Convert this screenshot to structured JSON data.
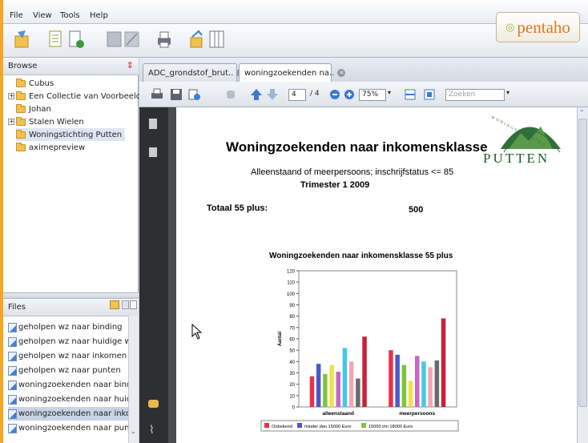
{
  "menu": {
    "file": "File",
    "view": "View",
    "tools": "Tools",
    "help": "Help"
  },
  "brand": {
    "logo_text": "pentaho",
    "accent": "#e07a1f"
  },
  "browse": {
    "header": "Browse",
    "folders": [
      {
        "label": "Cubus",
        "expandable": false
      },
      {
        "label": "Een Collectie van Voorbeelden",
        "expandable": true
      },
      {
        "label": "Johan",
        "expandable": false
      },
      {
        "label": "Stalen Wielen",
        "expandable": true
      },
      {
        "label": "Woningstichting Putten",
        "expandable": false,
        "selected": true
      },
      {
        "label": "aximepreview",
        "expandable": false
      }
    ]
  },
  "files": {
    "header": "Files",
    "items": [
      {
        "label": "geholpen wz naar binding"
      },
      {
        "label": "geholpen wz naar huidige woon"
      },
      {
        "label": "geholpen wz naar inkomen"
      },
      {
        "label": "geholpen wz naar punten"
      },
      {
        "label": "woningzoekenden naar binding"
      },
      {
        "label": "woningzoekenden naar huidige"
      },
      {
        "label": "woningzoekenden naar inkomer",
        "selected": true
      },
      {
        "label": "woningzoekenden naar punten"
      }
    ]
  },
  "tabs": [
    {
      "label": "ADC_grondstof_brut..",
      "active": false
    },
    {
      "label": "woningzoekenden na..",
      "active": true
    }
  ],
  "pdf_toolbar": {
    "page_current": "4",
    "page_total": "/ 4",
    "zoom": "75%",
    "search_placeholder": "Zoeken"
  },
  "document": {
    "title": "Woningzoekenden naar inkomensklasse",
    "subtitle": "Alleenstaand of meerpersoons; inschrijfstatus <= 85",
    "period": "Trimester 1   2009",
    "total_label": "Totaal 55 plus:",
    "total_value": "500",
    "logo_text": "PUTTEN",
    "logo_arc": "WONINGSTICHTING"
  },
  "chart_data": {
    "type": "bar",
    "title": "Woningzoekenden naar inkomensklasse 55 plus",
    "ylabel": "Aantal",
    "ylim": [
      0,
      120
    ],
    "yticks": [
      0,
      10,
      20,
      30,
      40,
      50,
      60,
      70,
      80,
      90,
      100,
      110,
      120
    ],
    "categories": [
      "alleenstaand",
      "meerpersoons"
    ],
    "series": [
      {
        "name": "Onbekend",
        "color": "#e8334a",
        "values": [
          27,
          50
        ]
      },
      {
        "name": "minder dan 15000 Euro",
        "color": "#4a58c8",
        "values": [
          38,
          46
        ]
      },
      {
        "name": "15000 t/m 18000 Euro",
        "color": "#7cc53a",
        "values": [
          29,
          37
        ]
      },
      {
        "name": "",
        "color": "#f2e04a",
        "values": [
          37,
          23
        ]
      },
      {
        "name": "",
        "color": "#c467c9",
        "values": [
          31,
          45
        ]
      },
      {
        "name": "",
        "color": "#44c8e8",
        "values": [
          52,
          40
        ]
      },
      {
        "name": "",
        "color": "#f2a6b4",
        "values": [
          40,
          35
        ]
      },
      {
        "name": "",
        "color": "#6a6a6a",
        "values": [
          25,
          41
        ]
      },
      {
        "name": "",
        "color": "#cc1f3a",
        "values": [
          62,
          78
        ]
      }
    ],
    "legend_position": "bottom"
  }
}
